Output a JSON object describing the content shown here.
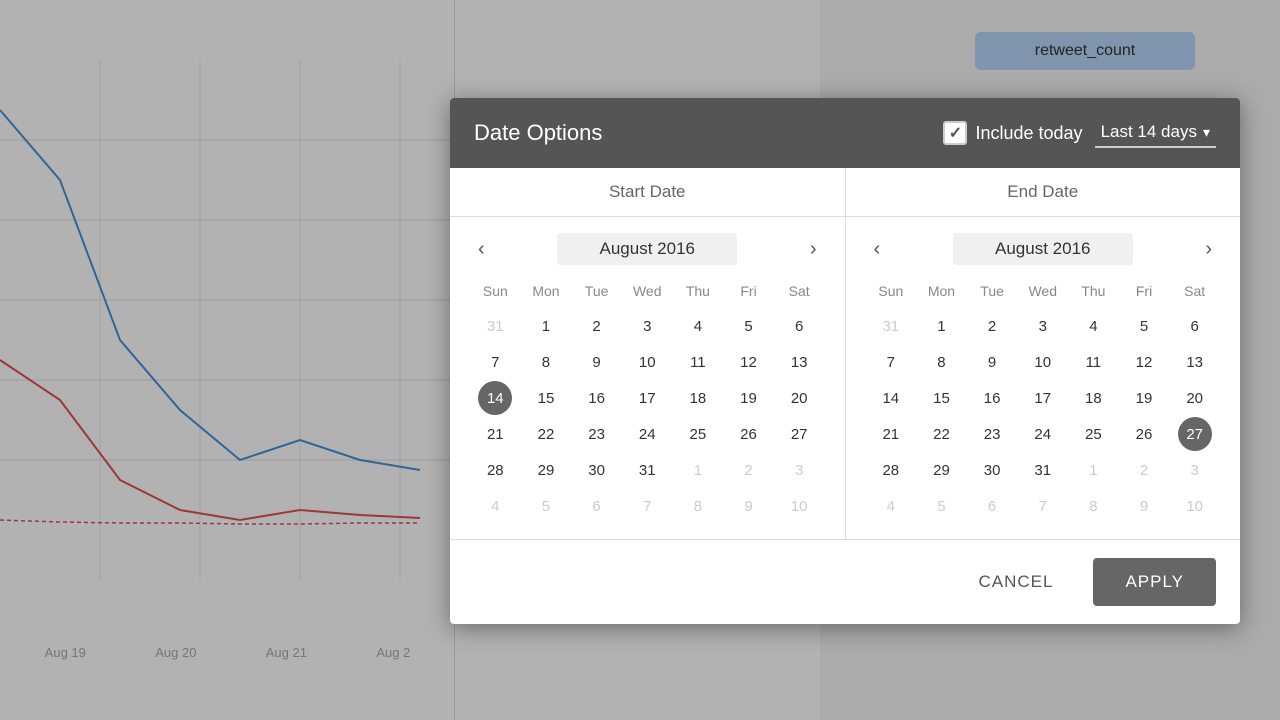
{
  "background": {
    "chart_labels": [
      "Aug 19",
      "Aug 20",
      "Aug 21",
      "Aug 2"
    ]
  },
  "right_panel": {
    "metric_label": "retweet_count"
  },
  "modal": {
    "title": "Date Options",
    "include_today_label": "Include today",
    "dropdown_label": "Last 14 days",
    "start_date_header": "Start Date",
    "end_date_header": "End Date",
    "cancel_label": "CANCEL",
    "apply_label": "APPLY"
  },
  "start_calendar": {
    "month_year": "August 2016",
    "days_of_week": [
      "Sun",
      "Mon",
      "Tue",
      "Wed",
      "Thu",
      "Fri",
      "Sat"
    ],
    "weeks": [
      [
        {
          "day": "31",
          "other": true
        },
        {
          "day": "1"
        },
        {
          "day": "2"
        },
        {
          "day": "3"
        },
        {
          "day": "4"
        },
        {
          "day": "5"
        },
        {
          "day": "6"
        }
      ],
      [
        {
          "day": "7"
        },
        {
          "day": "8"
        },
        {
          "day": "9"
        },
        {
          "day": "10"
        },
        {
          "day": "11"
        },
        {
          "day": "12"
        },
        {
          "day": "13"
        }
      ],
      [
        {
          "day": "14",
          "selected": true
        },
        {
          "day": "15"
        },
        {
          "day": "16"
        },
        {
          "day": "17"
        },
        {
          "day": "18"
        },
        {
          "day": "19"
        },
        {
          "day": "20"
        }
      ],
      [
        {
          "day": "21"
        },
        {
          "day": "22"
        },
        {
          "day": "23"
        },
        {
          "day": "24"
        },
        {
          "day": "25"
        },
        {
          "day": "26"
        },
        {
          "day": "27"
        }
      ],
      [
        {
          "day": "28"
        },
        {
          "day": "29"
        },
        {
          "day": "30"
        },
        {
          "day": "31"
        },
        {
          "day": "1",
          "other": true
        },
        {
          "day": "2",
          "other": true
        },
        {
          "day": "3",
          "other": true
        }
      ],
      [
        {
          "day": "4",
          "other": true
        },
        {
          "day": "5",
          "other": true
        },
        {
          "day": "6",
          "other": true
        },
        {
          "day": "7",
          "other": true
        },
        {
          "day": "8",
          "other": true
        },
        {
          "day": "9",
          "other": true
        },
        {
          "day": "10",
          "other": true
        }
      ]
    ]
  },
  "end_calendar": {
    "month_year": "August 2016",
    "days_of_week": [
      "Sun",
      "Mon",
      "Tue",
      "Wed",
      "Thu",
      "Fri",
      "Sat"
    ],
    "weeks": [
      [
        {
          "day": "31",
          "other": true
        },
        {
          "day": "1"
        },
        {
          "day": "2"
        },
        {
          "day": "3"
        },
        {
          "day": "4"
        },
        {
          "day": "5"
        },
        {
          "day": "6"
        }
      ],
      [
        {
          "day": "7"
        },
        {
          "day": "8"
        },
        {
          "day": "9"
        },
        {
          "day": "10"
        },
        {
          "day": "11"
        },
        {
          "day": "12"
        },
        {
          "day": "13"
        }
      ],
      [
        {
          "day": "14"
        },
        {
          "day": "15"
        },
        {
          "day": "16"
        },
        {
          "day": "17"
        },
        {
          "day": "18"
        },
        {
          "day": "19"
        },
        {
          "day": "20"
        }
      ],
      [
        {
          "day": "21"
        },
        {
          "day": "22"
        },
        {
          "day": "23"
        },
        {
          "day": "24"
        },
        {
          "day": "25"
        },
        {
          "day": "26"
        },
        {
          "day": "27",
          "selected": true
        }
      ],
      [
        {
          "day": "28"
        },
        {
          "day": "29"
        },
        {
          "day": "30"
        },
        {
          "day": "31"
        },
        {
          "day": "1",
          "other": true
        },
        {
          "day": "2",
          "other": true
        },
        {
          "day": "3",
          "other": true
        }
      ],
      [
        {
          "day": "4",
          "other": true
        },
        {
          "day": "5",
          "other": true
        },
        {
          "day": "6",
          "other": true
        },
        {
          "day": "7",
          "other": true
        },
        {
          "day": "8",
          "other": true
        },
        {
          "day": "9",
          "other": true
        },
        {
          "day": "10",
          "other": true
        }
      ]
    ]
  }
}
